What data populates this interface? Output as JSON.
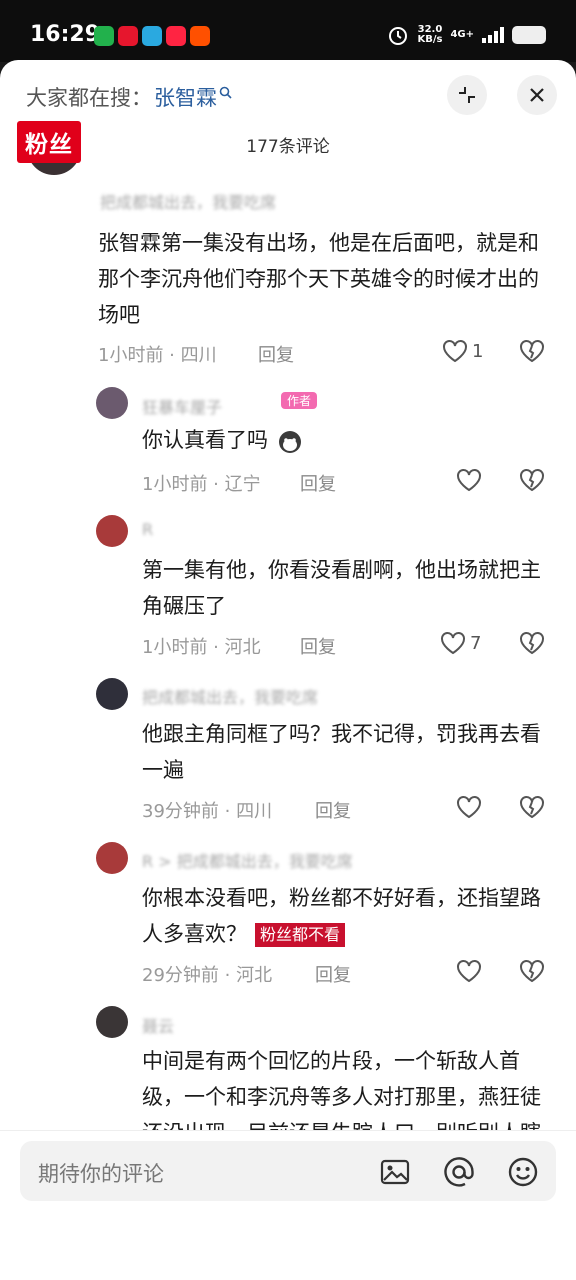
{
  "status_bar": {
    "time": "16:29",
    "net_speed_value": "32.0",
    "net_speed_unit": "KB/s",
    "network": "4G+",
    "app_icons": [
      "wechat-icon",
      "weibo-icon",
      "app-icon",
      "xiaohongshu-icon",
      "taobao-icon"
    ]
  },
  "header": {
    "search_prefix": "大家都在搜：",
    "search_keyword": "张智霖",
    "comment_count": "177条评论"
  },
  "annotations": {
    "fans_badge": "粉丝",
    "fans_note": "粉丝都不看"
  },
  "comments": [
    {
      "name": "把成都城出去，我要吃席",
      "text": "张智霖第一集没有出场，他是在后面吧，就是和那个李沉舟他们夺那个天下英雄令的时候才出的场吧",
      "meta": "1小时前 · 四川",
      "reply": "回复",
      "likes": "1"
    },
    {
      "name": "狂暴车厘子",
      "text": "你认真看了吗",
      "meta": "1小时前 · 辽宁",
      "reply": "回复",
      "likes": "",
      "tag": "作者"
    },
    {
      "name": "R",
      "text": "第一集有他，你看没看剧啊，他出场就把主角碾压了",
      "meta": "1小时前 · 河北",
      "reply": "回复",
      "likes": "7"
    },
    {
      "name": "把成都城出去，我要吃席",
      "text": "他跟主角同框了吗？我不记得，罚我再去看一遍",
      "meta": "39分钟前 · 四川",
      "reply": "回复",
      "likes": ""
    },
    {
      "name": "R > 把成都城出去，我要吃席",
      "text": "你根本没看吧，粉丝都不好好看，还指望路人多喜欢？",
      "meta": "29分钟前 · 河北",
      "reply": "回复",
      "likes": ""
    },
    {
      "name": "聂云",
      "text": "中间是有两个回忆的片段，一个斩敌人首级，一个和李沉舟等多人对打那里，燕狂徒还没出现，目前还是失踪人口。别听别人瞎吹就否定自己。",
      "meta": "",
      "reply": "",
      "likes": ""
    }
  ],
  "input": {
    "placeholder": "期待你的评论"
  },
  "colors": {
    "accent_link": "#2c5f9e",
    "fans_red": "#e0001a"
  }
}
